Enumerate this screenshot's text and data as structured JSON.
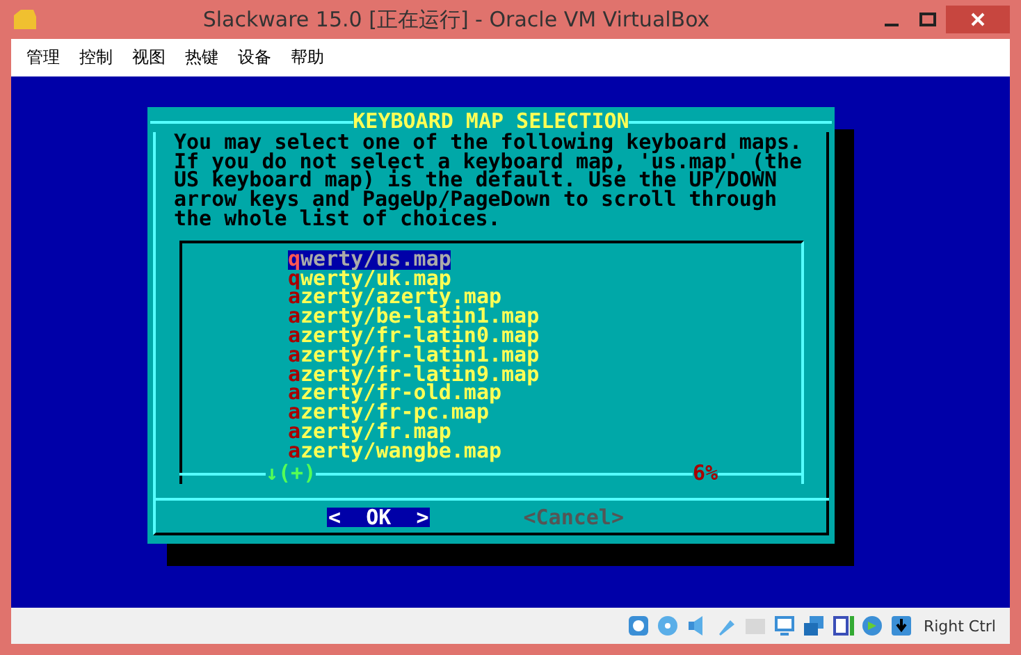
{
  "window": {
    "title": "Slackware 15.0 [正在运行] - Oracle VM VirtualBox"
  },
  "menu": [
    "管理",
    "控制",
    "视图",
    "热键",
    "设备",
    "帮助"
  ],
  "dialog": {
    "title": "KEYBOARD MAP SELECTION",
    "message": [
      "You may select one of the following keyboard maps.",
      "If you do not select a keyboard map, 'us.map' (the",
      "US keyboard map) is the default. Use the UP/DOWN",
      "arrow keys and PageUp/PageDown to scroll through",
      "the whole list of choices."
    ],
    "items": [
      {
        "label": "qwerty/us.map",
        "selected": true
      },
      {
        "label": "qwerty/uk.map",
        "selected": false
      },
      {
        "label": "azerty/azerty.map",
        "selected": false
      },
      {
        "label": "azerty/be-latin1.map",
        "selected": false
      },
      {
        "label": "azerty/fr-latin0.map",
        "selected": false
      },
      {
        "label": "azerty/fr-latin1.map",
        "selected": false
      },
      {
        "label": "azerty/fr-latin9.map",
        "selected": false
      },
      {
        "label": "azerty/fr-old.map",
        "selected": false
      },
      {
        "label": "azerty/fr-pc.map",
        "selected": false
      },
      {
        "label": "azerty/fr.map",
        "selected": false
      },
      {
        "label": "azerty/wangbe.map",
        "selected": false
      }
    ],
    "scroll_indicator": "↓(+)",
    "scroll_percent": "6%",
    "buttons": [
      {
        "label": "<  OK  >",
        "selected": true
      },
      {
        "label": "<Cancel>",
        "selected": false
      }
    ]
  },
  "status_bar": {
    "host_key": "Right Ctrl"
  }
}
